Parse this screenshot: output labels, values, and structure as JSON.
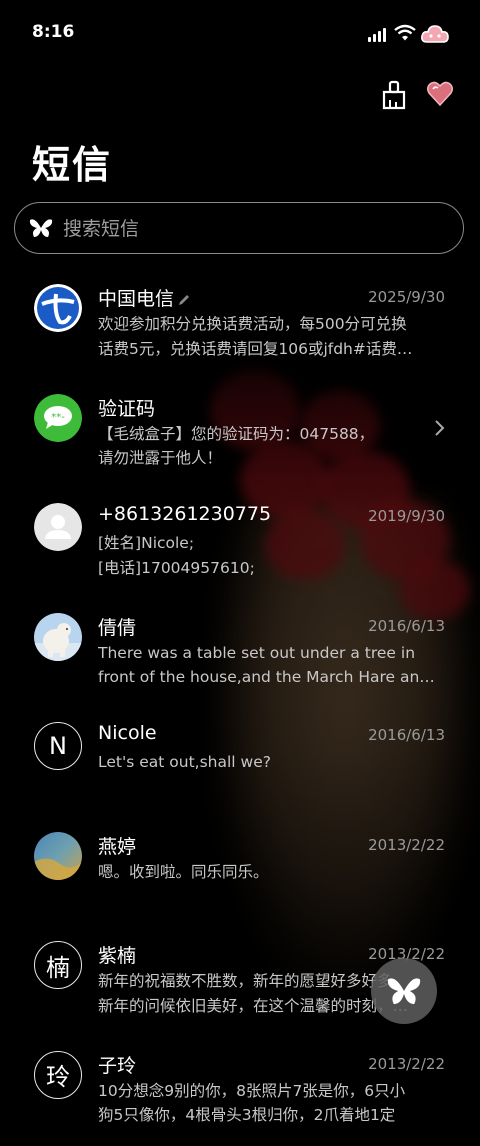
{
  "status_bar": {
    "time": "8:16"
  },
  "page": {
    "title": "短信"
  },
  "search": {
    "placeholder": "搜索短信"
  },
  "messages": [
    {
      "name": "中国电信",
      "date": "2025/9/30",
      "line1": "欢迎参加积分兑换话费活动，每500分可兑换",
      "line2": "话费5元，兑换话费请回复106或jfdh#话费…",
      "avatar": "china-telecom-logo"
    },
    {
      "name": "验证码",
      "date": "",
      "line1": "【毛绒盒子】您的验证码为：047588，",
      "line2": "请勿泄露于他人！",
      "avatar": "message-bubble"
    },
    {
      "name": "+8613261230775",
      "date": "2019/9/30",
      "line1": "[姓名]Nicole;",
      "line2": "[电话]17004957610;",
      "avatar": "default-person"
    },
    {
      "name": "倩倩",
      "date": "2016/6/13",
      "line1": "There was a table set out under a tree in",
      "line2": "front of the house,and the March Hare an…",
      "avatar": "polar-bear-photo"
    },
    {
      "name": "Nicole",
      "date": "2016/6/13",
      "line1": "Let's eat out,shall we?",
      "line2": "",
      "avatar_letter": "N"
    },
    {
      "name": "燕婷",
      "date": "2013/2/22",
      "line1": "嗯。收到啦。同乐同乐。",
      "line2": "",
      "avatar": "landscape-photo"
    },
    {
      "name": "紫楠",
      "date": "2013/2/22",
      "line1": "新年的祝福数不胜数，新年的愿望好多好多，",
      "line2": "新年的问候依旧美好，在这个温馨的时刻，…",
      "avatar_letter": "楠"
    },
    {
      "name": "子玲",
      "date": "2013/2/22",
      "line1": "10分想念9别的你，8张照片7张是你，6只小",
      "line2": "狗5只像你，4根骨头3根归你，2爪着地1定",
      "avatar_letter": "玲"
    }
  ],
  "colors": {
    "background": "#000000",
    "secondary_text": "#9a9a9a",
    "preview_text": "#c8c8c8"
  }
}
